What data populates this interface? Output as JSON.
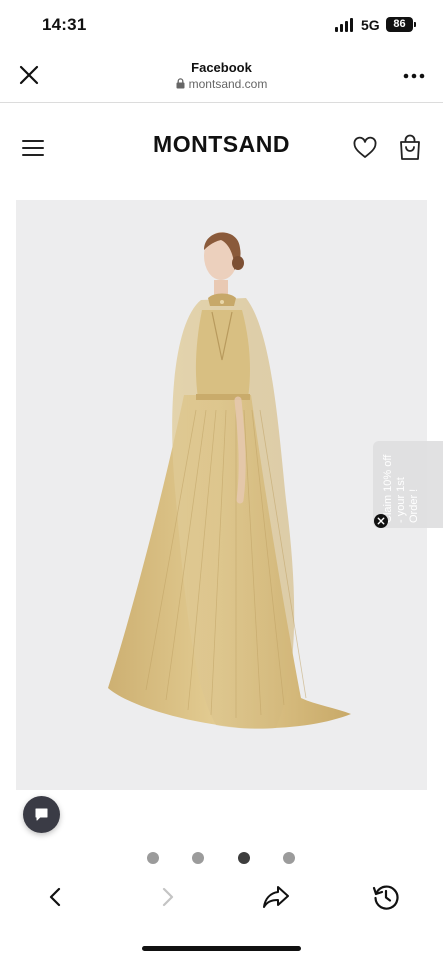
{
  "status_bar": {
    "time": "14:31",
    "network": "5G",
    "battery": "86"
  },
  "browser": {
    "title": "Facebook",
    "url": "montsand.com"
  },
  "site": {
    "brand": "MONTSAND"
  },
  "promo": {
    "text": "Claim 10% off - your 1st Order !"
  },
  "carousel": {
    "total_slides": 4,
    "active_slide": 3
  },
  "toolbar": {
    "back_enabled": true,
    "forward_enabled": false
  },
  "colors": {
    "image_background": "#ededee",
    "dress_gold": "#d9bf7f",
    "chat_bubble": "#3a3b45",
    "dot_active": "#3d3d3d",
    "dot_inactive": "#9b9b9b"
  },
  "icons": {
    "close": "close-icon",
    "lock": "lock-icon",
    "more": "more-dots-icon",
    "menu": "hamburger-menu-icon",
    "wishlist": "heart-icon",
    "cart": "shopping-bag-icon",
    "chat": "chat-bubble-icon",
    "back": "chevron-left-icon",
    "forward": "chevron-right-icon",
    "share": "share-arrow-icon",
    "history": "history-clock-icon"
  }
}
